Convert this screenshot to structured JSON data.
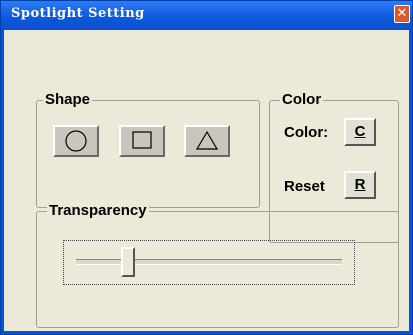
{
  "window": {
    "title": "Spotlight Setting",
    "close_glyph": "✕"
  },
  "shape": {
    "label": "Shape",
    "buttons": [
      {
        "icon": "circle-icon"
      },
      {
        "icon": "square-icon"
      },
      {
        "icon": "triangle-icon"
      }
    ]
  },
  "color": {
    "label": "Color",
    "color_label": "Color:",
    "color_button": "C",
    "reset_label": "Reset",
    "reset_button": "R"
  },
  "transparency": {
    "label": "Transparency",
    "value_fraction": 0.18
  }
}
